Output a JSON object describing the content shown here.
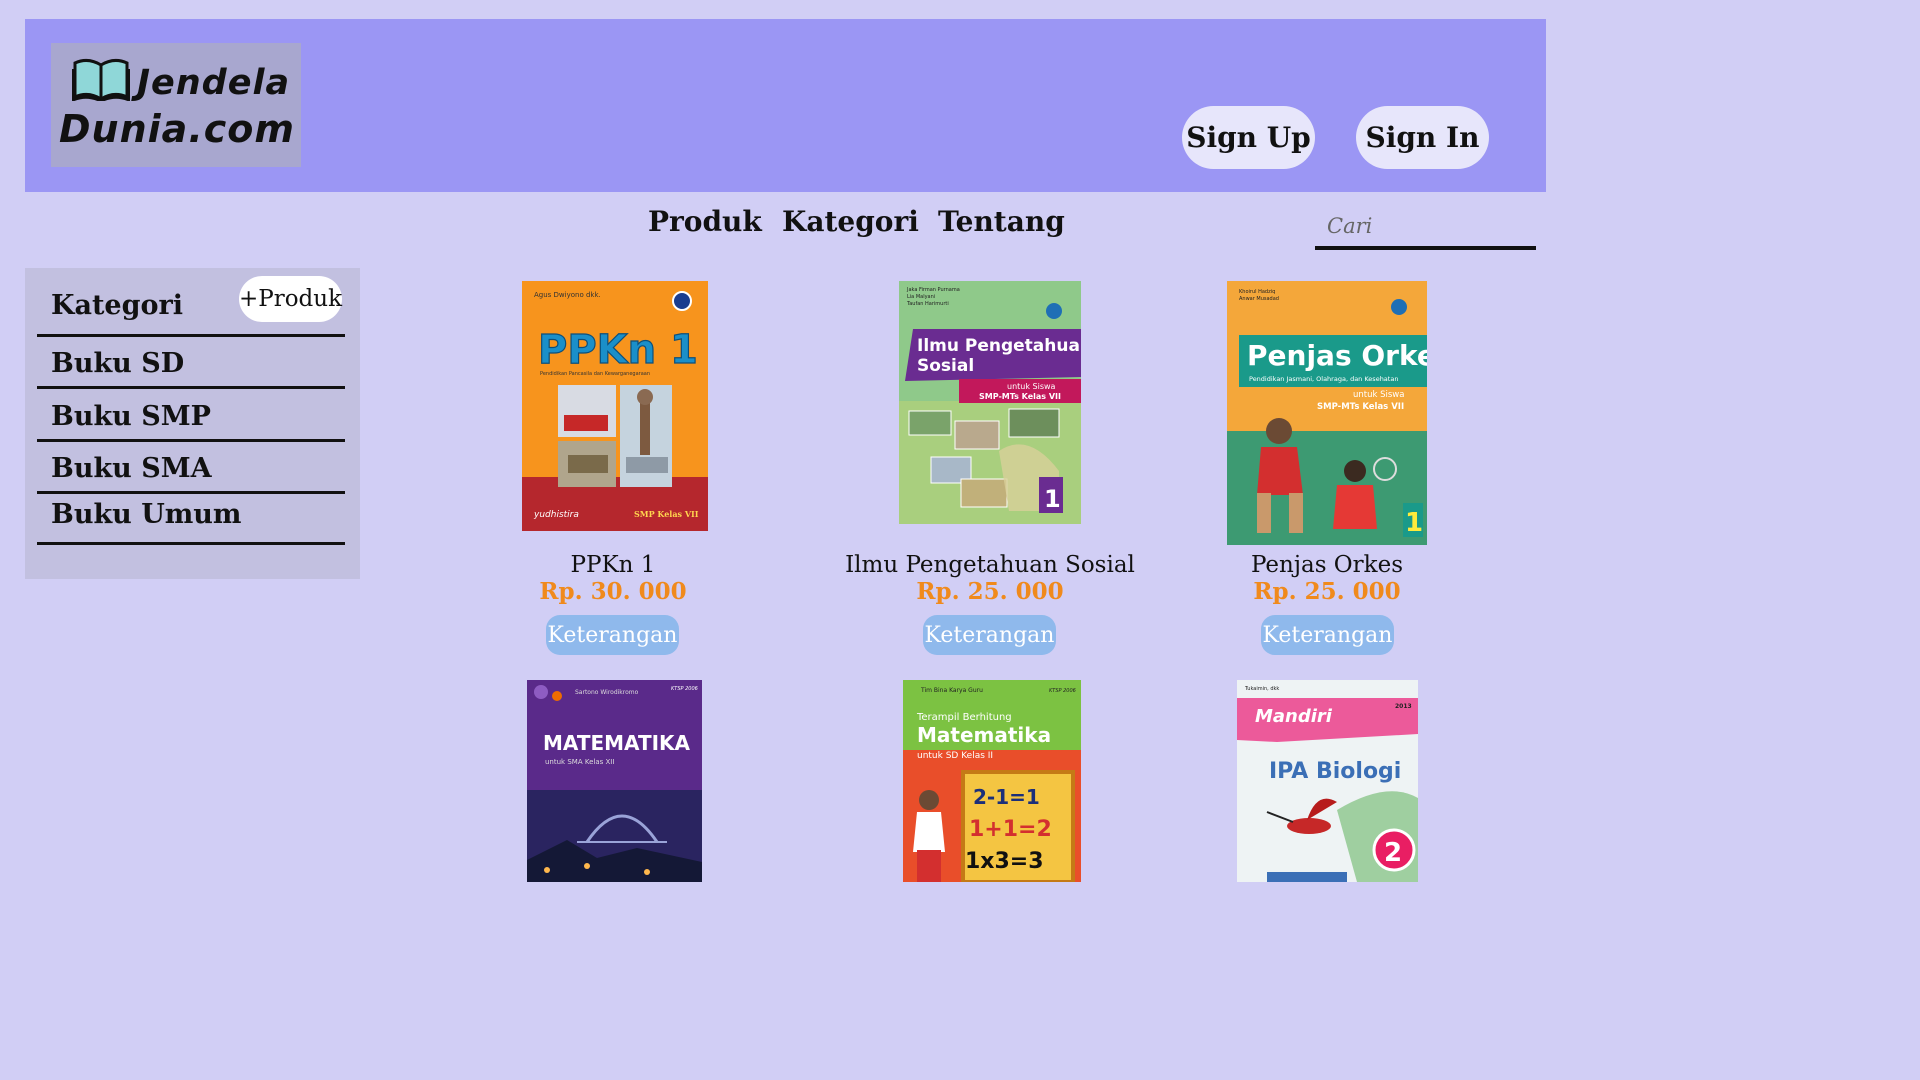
{
  "header": {
    "logo_line1": "Jendela",
    "logo_line2": "Dunia.com",
    "signup_label": "Sign Up",
    "signin_label": "Sign In"
  },
  "nav": {
    "items": [
      "Produk",
      "Kategori",
      "Tentang"
    ],
    "search_placeholder": "Cari"
  },
  "sidebar": {
    "title": "Kategori",
    "add_label": "+Produk",
    "items": [
      "Buku SD",
      "Buku SMP",
      "Buku SMA",
      "Buku Umum"
    ]
  },
  "products": [
    {
      "name": "PPKn 1",
      "price": "Rp. 30. 000",
      "button": "Keterangan",
      "cover": {
        "author": "Agus Dwiyono dkk.",
        "title": "PPKn 1",
        "subtitle": "Pendidikan Pancasila dan Kewarganegaraan",
        "publisher": "yudhistira",
        "grade": "SMP Kelas VII"
      }
    },
    {
      "name": "Ilmu Pengetahuan Sosial",
      "price": "Rp. 25. 000",
      "button": "Keterangan",
      "cover": {
        "authors": [
          "Jaka Firman Purnama",
          "Lia Malyani",
          "Taufan Harimurti"
        ],
        "title_l1": "Ilmu Pengetahuan",
        "title_l2": "Sosial",
        "sub_l1": "untuk Siswa",
        "sub_l2": "SMP-MTs Kelas VII",
        "vol": "1"
      }
    },
    {
      "name": "Penjas Orkes",
      "price": "Rp. 25. 000",
      "button": "Keterangan",
      "cover": {
        "authors": [
          "Khoirul Hadziq",
          "Anwar Musadad"
        ],
        "title": "Penjas Orkes",
        "subtitle": "Pendidikan Jasmani, Olahraga, dan Kesehatan",
        "sub_l1": "untuk Siswa",
        "sub_l2": "SMP-MTs Kelas VII",
        "vol": "1"
      }
    },
    {
      "cover": {
        "author": "Sartono Wirodikromo",
        "badge": "KTSP 2006",
        "title": "MATEMATIKA",
        "subtitle": "untuk SMA Kelas XII"
      }
    },
    {
      "cover": {
        "author": "Tim Bina Karya Guru",
        "badge": "KTSP 2006",
        "title_l1": "Terampil Berhitung",
        "title_l2": "Matematika",
        "subtitle": "untuk SD Kelas II",
        "eq1": "2-1=1",
        "eq2": "1+1=2",
        "eq3": "1x3=3"
      }
    },
    {
      "cover": {
        "author": "Tukaimin, dkk",
        "badge": "2013",
        "brand": "Mandiri",
        "title": "IPA Biologi",
        "vol": "2"
      }
    }
  ],
  "colors": {
    "background": "#d1cef5",
    "header": "#9b96f4",
    "price": "#f08a1c",
    "button": "#8fb9ec"
  }
}
